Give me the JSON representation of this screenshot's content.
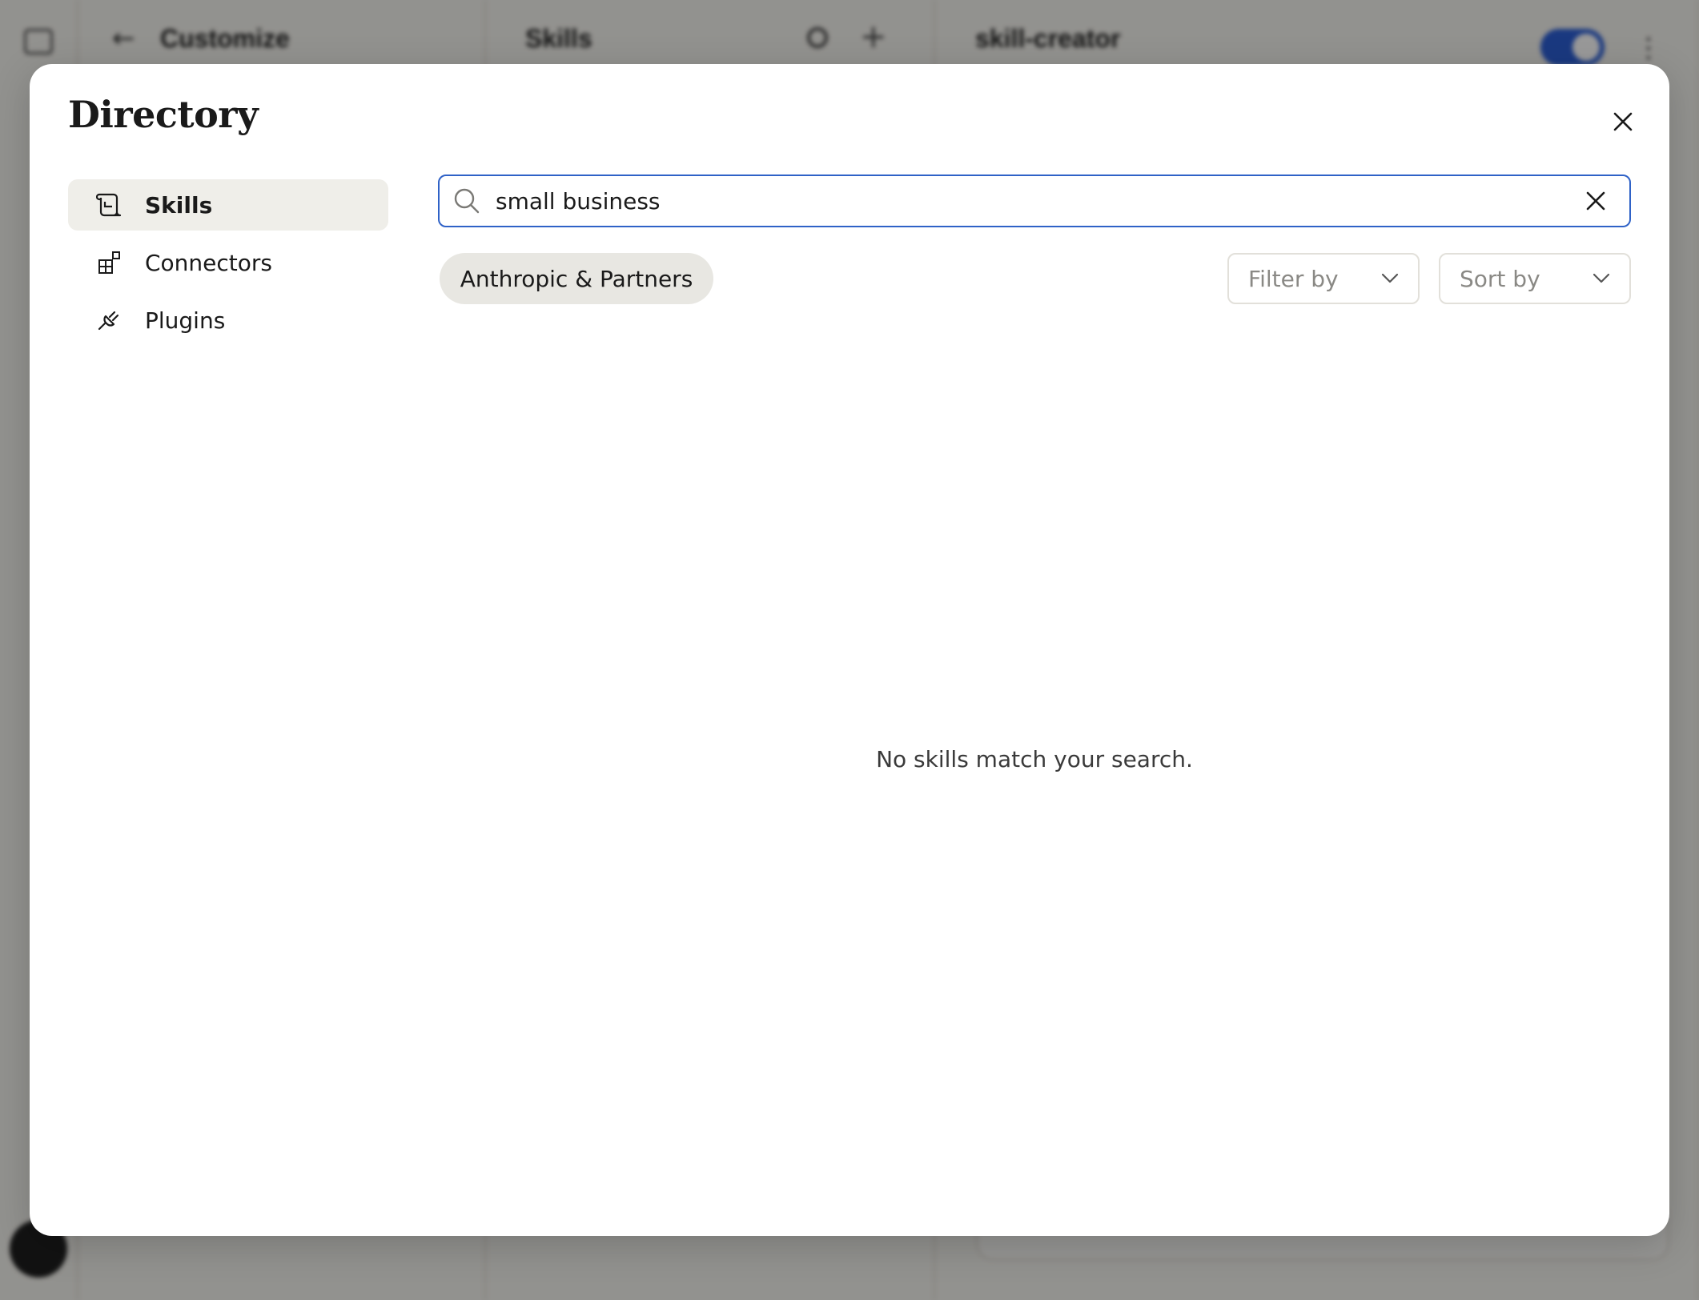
{
  "background": {
    "left_title": "Customize",
    "middle_title": "Skills",
    "right_title": "skill-creator"
  },
  "modal": {
    "title": "Directory",
    "nav": [
      {
        "label": "Skills",
        "icon": "scroll-icon",
        "active": true
      },
      {
        "label": "Connectors",
        "icon": "grid-plus-icon",
        "active": false
      },
      {
        "label": "Plugins",
        "icon": "plug-icon",
        "active": false
      }
    ],
    "search": {
      "value": "small business"
    },
    "chip_label": "Anthropic & Partners",
    "filter_label": "Filter by",
    "sort_label": "Sort by",
    "empty_message": "No skills match your search."
  },
  "colors": {
    "focus_border": "#2f62c7",
    "active_nav_bg": "#efeee9",
    "chip_bg": "#e8e7e2",
    "toggle_on": "#2c5fd6"
  }
}
